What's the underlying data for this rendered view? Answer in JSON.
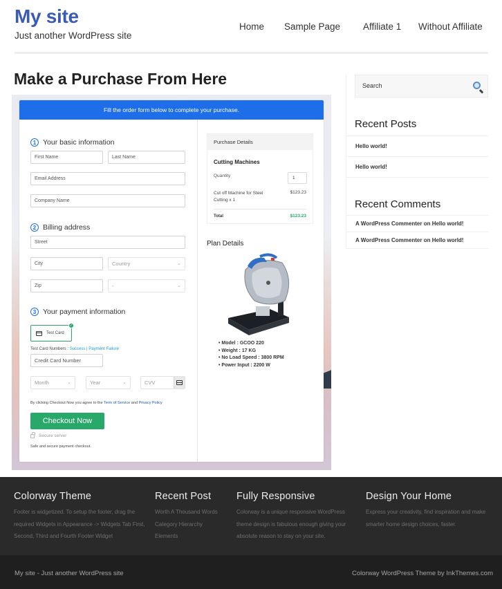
{
  "header": {
    "site_title": "My site",
    "tagline": "Just another WordPress site",
    "nav": [
      {
        "label": "Home"
      },
      {
        "label": "Sample Page"
      },
      {
        "label": "Affiliate 1"
      },
      {
        "label": "Without Affiliate"
      }
    ]
  },
  "page": {
    "title": "Make a Purchase From Here"
  },
  "order_form": {
    "banner": "Fill the order form below to complete your purchase.",
    "steps": [
      {
        "number": "1",
        "label": "Your basic information"
      },
      {
        "number": "2",
        "label": "Billing address"
      },
      {
        "number": "3",
        "label": "Your payment information"
      }
    ],
    "fields": {
      "first_name": "First Name",
      "last_name": "Last Name",
      "email": "Email Address",
      "company": "Company Name",
      "street": "Street",
      "city": "City",
      "country": "Country",
      "zip": "Zip",
      "state": "-",
      "card_number": "Credit Card Number",
      "month": "Month",
      "year": "Year",
      "cvv": "CVV"
    },
    "payment_method": "Test Card",
    "test_card_label": "Test Card Numbers : ",
    "test_success": "Success",
    "test_separator": " | ",
    "test_failure": "Payment Failure",
    "agree_prefix": "By clicking Checkout Now you agree to the ",
    "terms_link": "Term of Service",
    "agree_and": " and ",
    "privacy_link": "Privacy Policy",
    "checkout_button": "Checkout Now",
    "secure_server": "Secure server",
    "safe_text": "Safe and secure payment checkout."
  },
  "purchase_details": {
    "heading": "Purchase Details",
    "product_group": "Cutting Machines",
    "quantity_label": "Quantity",
    "quantity_value": "1",
    "item_name": "Cut off Machine for Steel Cutting x 1",
    "item_price": "$123.23",
    "total_label": "Total",
    "total_value": "$123.23",
    "plan_heading": "Plan Details",
    "specs": [
      "Model : GCOO 220",
      "Weight : 17 KG",
      "No Load Speed : 3800 RPM",
      "Power Input : 2200 W"
    ]
  },
  "sidebar": {
    "search_placeholder": "Search",
    "recent_posts_title": "Recent Posts",
    "recent_posts": [
      "Hello world!",
      "Hello world!"
    ],
    "recent_comments_title": "Recent Comments",
    "recent_comments": [
      "A WordPress Commenter on Hello world!",
      "A WordPress Commenter on Hello world!"
    ]
  },
  "footer": {
    "columns": [
      {
        "title": "Colorway Theme",
        "text": "Footer is widgetized. To setup the footer, drag the required Widgets in Appearance -> Widgets Tab First, Second, Third and Fourth Footer Widget"
      },
      {
        "title": "Recent Post",
        "items": [
          "Worth A Thousand Words",
          "Category Hierarchy",
          "Elements"
        ]
      },
      {
        "title": "Fully Responsive",
        "text": "Colorway is a unique responsive WordPress theme design is fabulous enough giving your absolute reason to stay on your site."
      },
      {
        "title": "Design Your Home",
        "text": "Express your creativity, find inspiration and make smarter home design choices, faster."
      }
    ],
    "bottom_left": "My site - Just another WordPress site",
    "bottom_right": "Colorway WordPress Theme by InkThemes.com"
  },
  "colors": {
    "brand_blue": "#3a5bb4",
    "banner_blue": "#1d6ee8",
    "checkout_green": "#28a869",
    "footer_bg": "#2a2a2a"
  }
}
